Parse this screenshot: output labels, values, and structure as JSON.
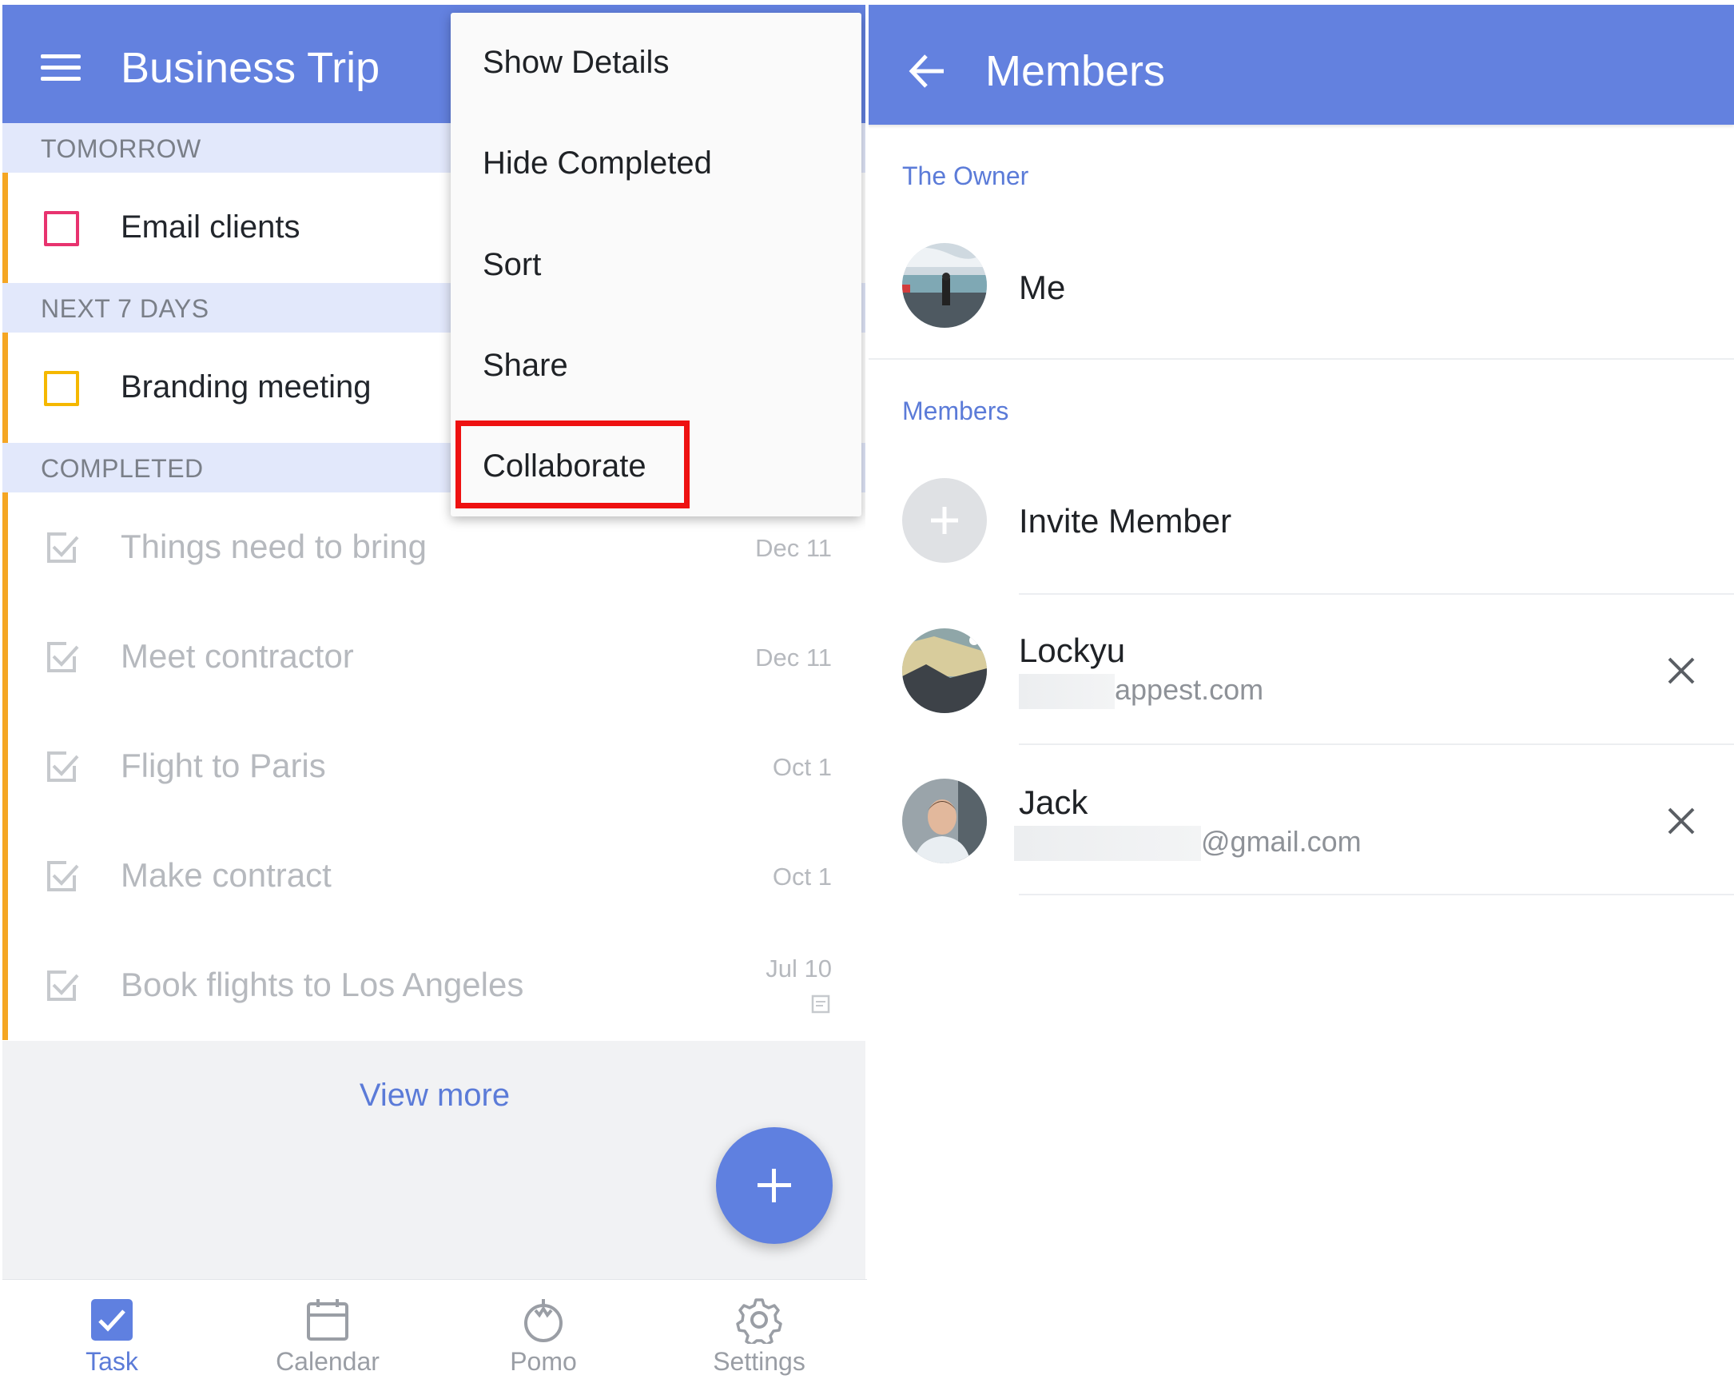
{
  "left": {
    "header": {
      "title": "Business Trip"
    },
    "sections": {
      "tomorrow": "TOMORROW",
      "next7": "NEXT 7 DAYS",
      "completed": "COMPLETED"
    },
    "tasks": [
      {
        "title": "Email clients",
        "priority_color": "#e8336f"
      },
      {
        "title": "Branding meeting",
        "priority_color": "#f5b800"
      }
    ],
    "completed_tasks": [
      {
        "title": "Things need to bring",
        "date": "Dec 11"
      },
      {
        "title": "Meet contractor",
        "date": "Dec 11"
      },
      {
        "title": "Flight to Paris",
        "date": "Oct 1"
      },
      {
        "title": "Make contract",
        "date": "Oct 1"
      },
      {
        "title": "Book flights to Los Angeles",
        "date": "Jul 10",
        "has_note": true
      }
    ],
    "view_more": "View more",
    "menu": {
      "items": [
        "Show Details",
        "Hide Completed",
        "Sort",
        "Share",
        "Collaborate"
      ],
      "highlighted": "Collaborate"
    },
    "bottom_nav": [
      {
        "label": "Task",
        "icon": "task-check-icon",
        "active": true
      },
      {
        "label": "Calendar",
        "icon": "calendar-icon",
        "active": false
      },
      {
        "label": "Pomo",
        "icon": "pomo-icon",
        "active": false
      },
      {
        "label": "Settings",
        "icon": "gear-icon",
        "active": false
      }
    ]
  },
  "right": {
    "header": {
      "title": "Members"
    },
    "owner_heading": "The Owner",
    "owner": {
      "name": "Me"
    },
    "members_heading": "Members",
    "invite_label": "Invite Member",
    "members": [
      {
        "name": "Lockyu",
        "email_visible": "appest.com"
      },
      {
        "name": "Jack",
        "email_visible": "@gmail.com"
      }
    ]
  },
  "colors": {
    "header": "#6381df",
    "accent": "#5b7bd8",
    "section_bg": "#e2e8fb",
    "list_bar": "#f5a623",
    "highlight": "#ee1111"
  }
}
